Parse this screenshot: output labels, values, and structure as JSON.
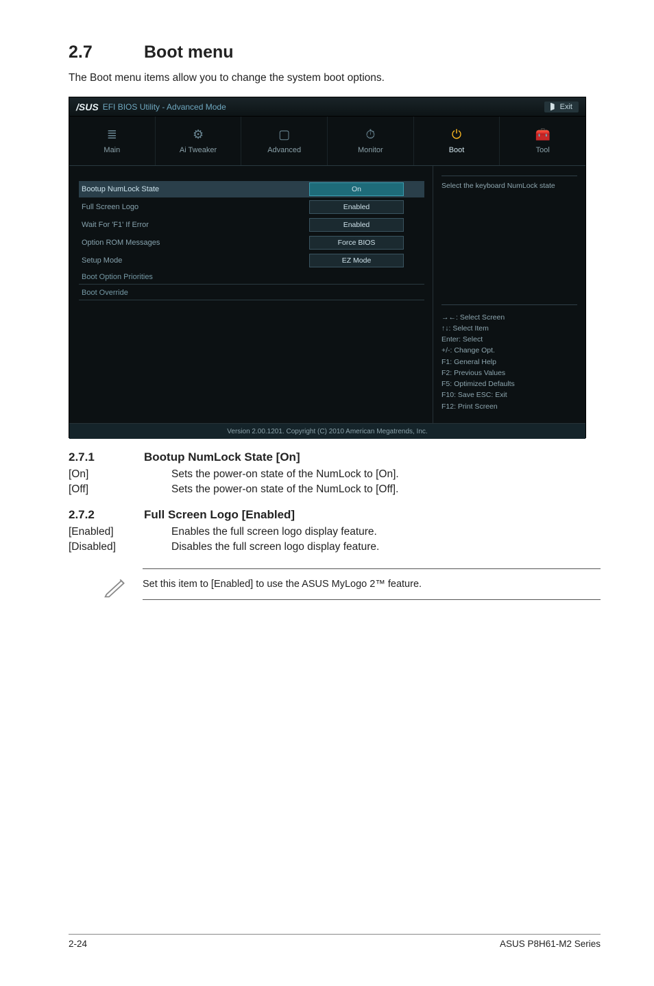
{
  "section": {
    "number": "2.7",
    "title": "Boot menu",
    "intro": "The Boot menu items allow you to change the system boot options."
  },
  "bios": {
    "brand_prefix": "/SUS",
    "title": "EFI BIOS Utility - Advanced Mode",
    "exit": "Exit",
    "tabs": [
      {
        "icon": "list",
        "label": "Main"
      },
      {
        "icon": "gear",
        "label": "Ai  Tweaker"
      },
      {
        "icon": "chip",
        "label": "Advanced"
      },
      {
        "icon": "monitor",
        "label": "Monitor"
      },
      {
        "icon": "power",
        "label": "Boot"
      },
      {
        "icon": "tool",
        "label": "Tool"
      }
    ],
    "settings": [
      {
        "label": "Bootup NumLock State",
        "value": "On",
        "selected": true
      },
      {
        "label": "Full Screen Logo",
        "value": "Enabled"
      },
      {
        "label": "Wait For 'F1' If Error",
        "value": "Enabled"
      },
      {
        "label": "Option ROM Messages",
        "value": "Force BIOS"
      },
      {
        "label": "Setup Mode",
        "value": "EZ Mode"
      }
    ],
    "sections": [
      "Boot Option Priorities",
      "Boot Override"
    ],
    "hint": "Select the keyboard NumLock state",
    "nav_help": [
      "→←: Select Screen",
      "↑↓: Select Item",
      "Enter: Select",
      "+/-: Change Opt.",
      "F1: General Help",
      "F2: Previous Values",
      "F5: Optimized Defaults",
      "F10: Save   ESC: Exit",
      "F12: Print Screen"
    ],
    "version": "Version  2.00.1201.   Copyright  (C)  2010  American  Megatrends,  Inc."
  },
  "subsections": [
    {
      "number": "2.7.1",
      "title": "Bootup NumLock State [On]",
      "defs": [
        {
          "key": "[On]",
          "text": "Sets the power-on state of the NumLock to [On]."
        },
        {
          "key": "[Off]",
          "text": "Sets the power-on state of the NumLock to [Off]."
        }
      ]
    },
    {
      "number": "2.7.2",
      "title": "Full Screen Logo [Enabled]",
      "defs": [
        {
          "key": "[Enabled]",
          "text": "Enables the full screen logo display feature."
        },
        {
          "key": "[Disabled]",
          "text": "Disables the full screen logo display feature."
        }
      ]
    }
  ],
  "note": "Set this item to [Enabled] to use the ASUS MyLogo 2™ feature.",
  "footer": {
    "left": "2-24",
    "right": "ASUS P8H61-M2 Series"
  }
}
